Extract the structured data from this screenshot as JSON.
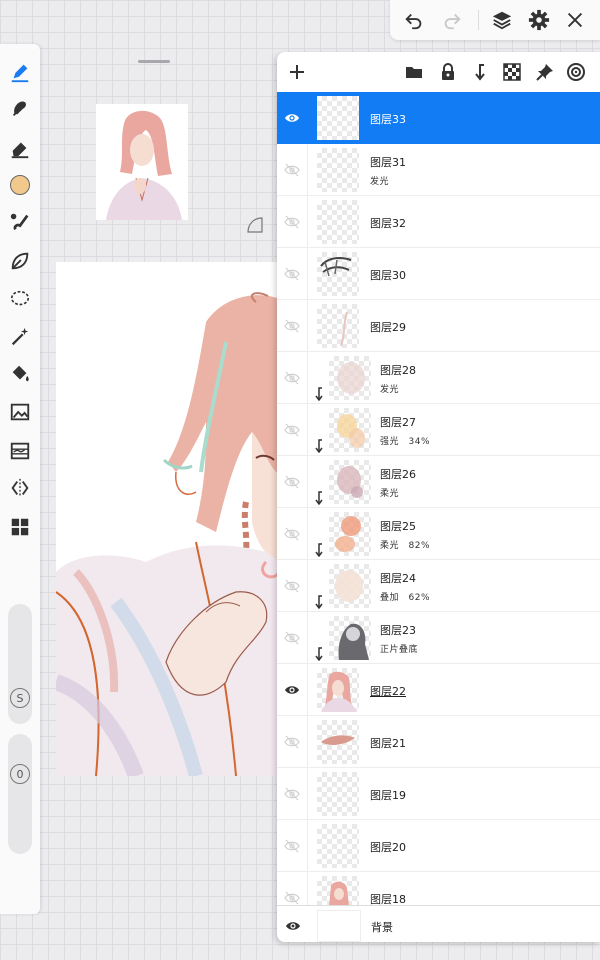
{
  "layers_panel": {
    "layers": [
      {
        "name": "图层33",
        "sub": "",
        "visible": true,
        "selected": true,
        "clipped": false,
        "underline": false
      },
      {
        "name": "图层31",
        "sub": "发光",
        "visible": false,
        "selected": false,
        "clipped": false,
        "underline": false
      },
      {
        "name": "图层32",
        "sub": "",
        "visible": false,
        "selected": false,
        "clipped": false,
        "underline": false
      },
      {
        "name": "图层30",
        "sub": "",
        "visible": false,
        "selected": false,
        "clipped": false,
        "underline": false
      },
      {
        "name": "图层29",
        "sub": "",
        "visible": false,
        "selected": false,
        "clipped": false,
        "underline": false
      },
      {
        "name": "图层28",
        "sub": "发光",
        "visible": false,
        "selected": false,
        "clipped": true,
        "underline": false
      },
      {
        "name": "图层27",
        "sub": "强光　34%",
        "visible": false,
        "selected": false,
        "clipped": true,
        "underline": false
      },
      {
        "name": "图层26",
        "sub": "柔光",
        "visible": false,
        "selected": false,
        "clipped": true,
        "underline": false
      },
      {
        "name": "图层25",
        "sub": "柔光　82%",
        "visible": false,
        "selected": false,
        "clipped": true,
        "underline": false
      },
      {
        "name": "图层24",
        "sub": "叠加　62%",
        "visible": false,
        "selected": false,
        "clipped": true,
        "underline": false
      },
      {
        "name": "图层23",
        "sub": "正片叠底",
        "visible": false,
        "selected": false,
        "clipped": true,
        "underline": false
      },
      {
        "name": "图层22",
        "sub": "",
        "visible": true,
        "selected": false,
        "clipped": false,
        "underline": true
      },
      {
        "name": "图层21",
        "sub": "",
        "visible": false,
        "selected": false,
        "clipped": false,
        "underline": false
      },
      {
        "name": "图层19",
        "sub": "",
        "visible": false,
        "selected": false,
        "clipped": false,
        "underline": false
      },
      {
        "name": "图层20",
        "sub": "",
        "visible": false,
        "selected": false,
        "clipped": false,
        "underline": false
      },
      {
        "name": "图层18",
        "sub": "",
        "visible": false,
        "selected": false,
        "clipped": false,
        "underline": false
      }
    ],
    "background_layer": {
      "name": "背景",
      "visible": true
    }
  },
  "left_toolbar": {
    "size_label": "S",
    "opacity_label": "0",
    "current_color": "#f2c98d"
  },
  "colors": {
    "accent": "#127cf5",
    "panel_bg": "#ffffff"
  },
  "icons": {
    "top_bar": [
      "undo-icon",
      "redo-icon",
      "layers-icon",
      "settings-icon",
      "close-icon"
    ],
    "panel_toolbar": [
      "add-icon",
      "folder-icon",
      "lock-icon",
      "clip-down-icon",
      "transparency-icon",
      "pin-icon",
      "target-icon"
    ]
  }
}
